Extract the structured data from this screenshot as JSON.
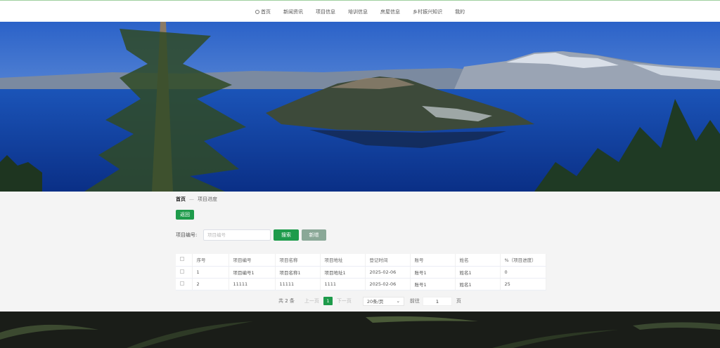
{
  "nav": {
    "items": [
      {
        "label": "首页",
        "icon": "home-icon"
      },
      {
        "label": "新闻资讯"
      },
      {
        "label": "项目信息"
      },
      {
        "label": "培训信息"
      },
      {
        "label": "房屋信息"
      },
      {
        "label": "乡村振兴知识"
      },
      {
        "label": "我的"
      }
    ]
  },
  "breadcrumb": {
    "home": "首页",
    "separator": "—",
    "current": "项目进度"
  },
  "actions": {
    "back": "返回",
    "search": "搜索",
    "add": "新增"
  },
  "search": {
    "label": "项目编号:",
    "placeholder": "项目编号",
    "value": ""
  },
  "table": {
    "headers": [
      "序号",
      "项目编号",
      "项目名称",
      "项目地址",
      "登记时间",
      "账号",
      "姓名",
      "%（项目进度）"
    ],
    "rows": [
      [
        "1",
        "项目编号1",
        "项目名称1",
        "项目地址1",
        "2025-02-06",
        "账号1",
        "姓名1",
        "0"
      ],
      [
        "2",
        "11111",
        "11111",
        "1111",
        "2025-02-06",
        "账号1",
        "姓名1",
        "25"
      ]
    ]
  },
  "pagination": {
    "total": "共 2 条",
    "prev": "上一页",
    "current": "1",
    "next": "下一页",
    "page_size": "20条/页",
    "goto": "前往",
    "goto_value": "1",
    "unit": "页"
  },
  "colors": {
    "accent": "#1e9b4b",
    "secondary": "#8aa897",
    "footer": "#1a1d18"
  }
}
